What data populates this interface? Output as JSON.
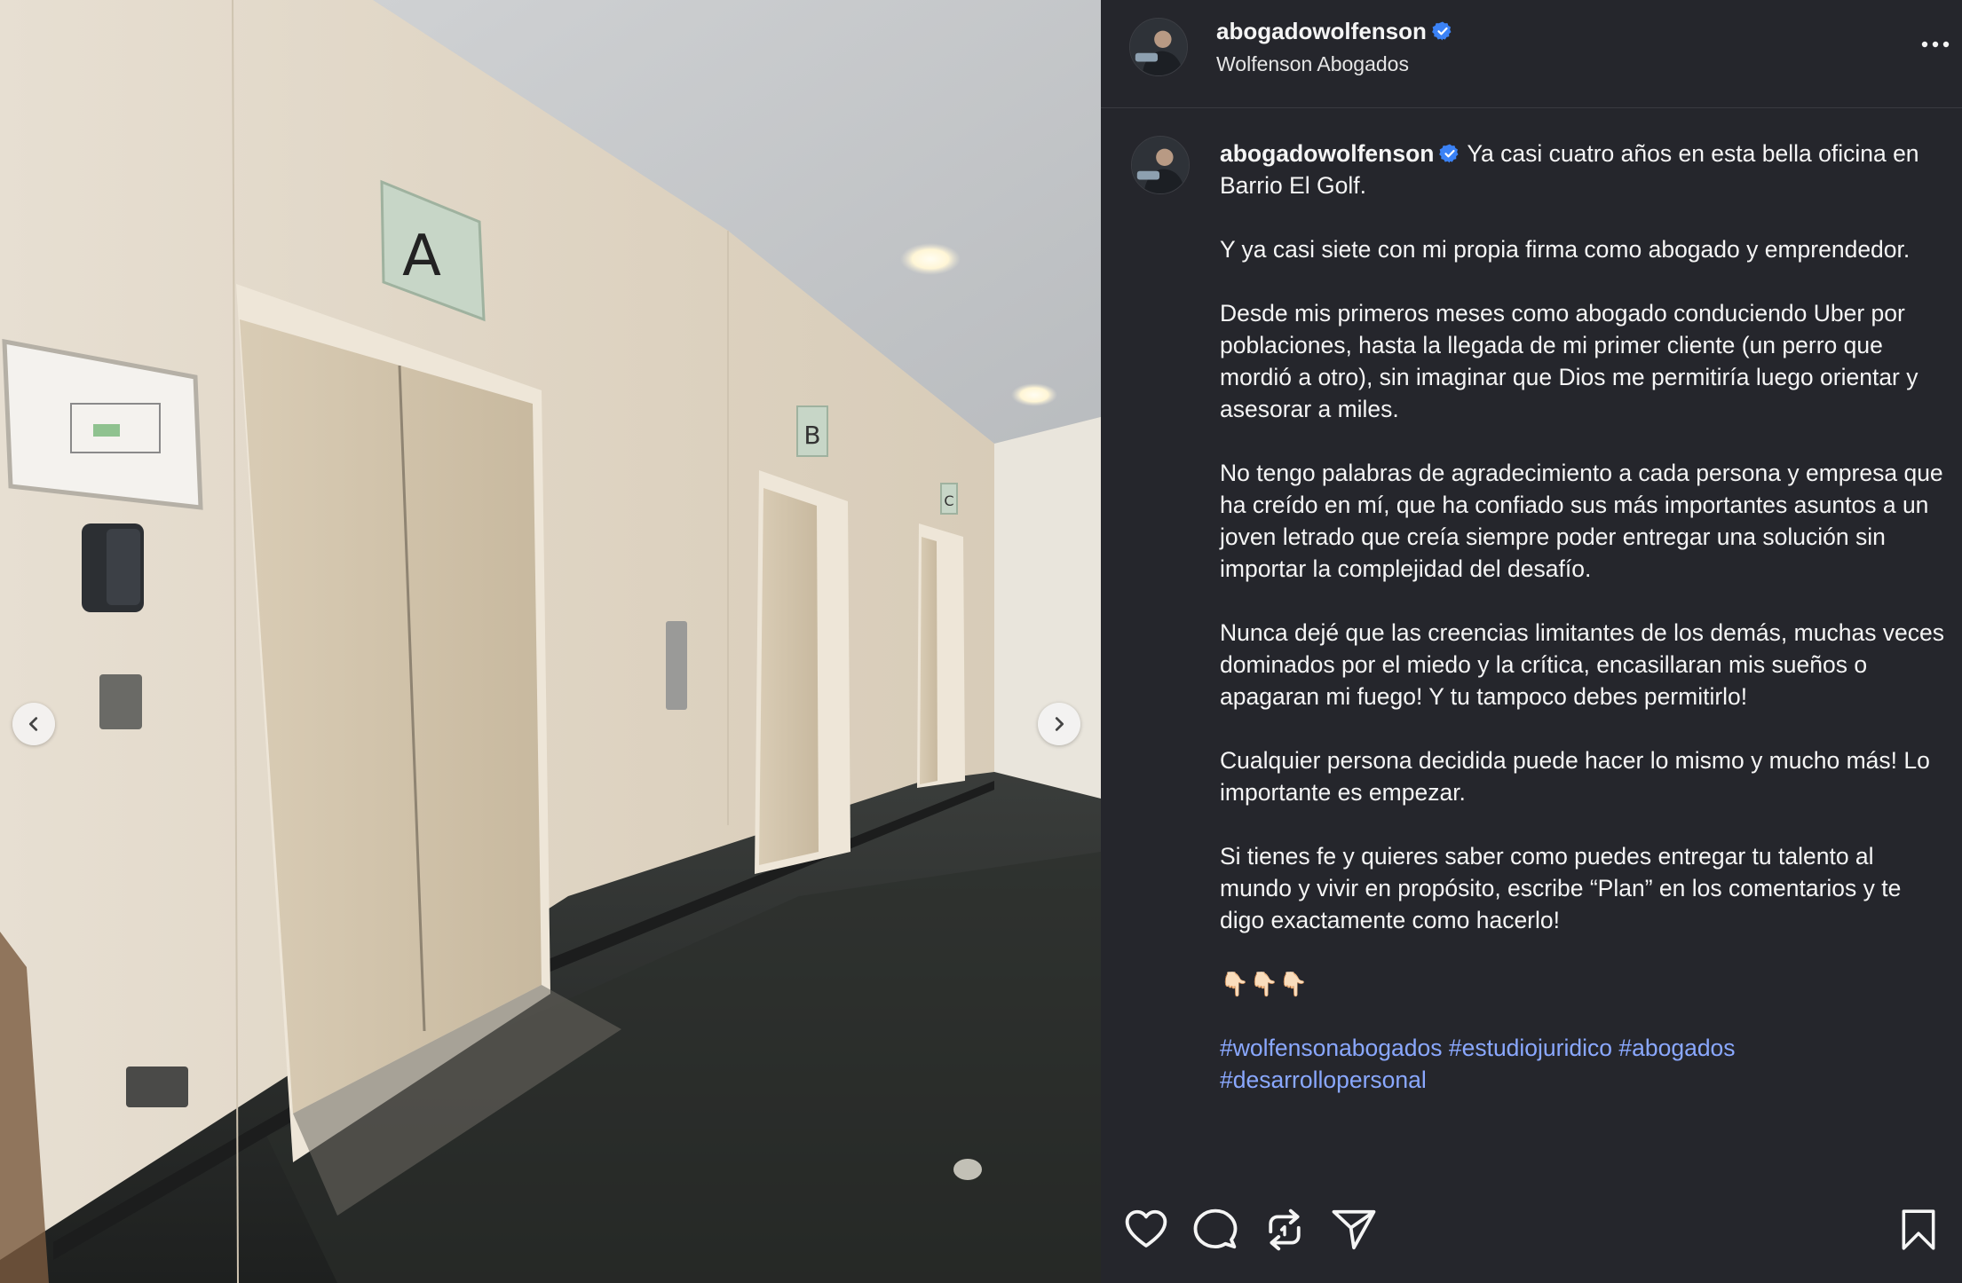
{
  "post": {
    "username": "abogadowolfenson",
    "verified": true,
    "subtitle": "Wolfenson Abogados"
  },
  "caption": {
    "username": "abogadowolfenson",
    "text": " Ya casi cuatro años en esta bella oficina en Barrio El Golf.\n\nY ya casi siete con mi propia firma como abogado y emprendedor.\n\nDesde mis primeros meses como abogado conduciendo Uber por poblaciones, hasta la llegada de mi primer cliente (un perro que mordió a otro), sin imaginar que Dios me permitiría luego orientar y asesorar a miles.\n\nNo tengo palabras de agradecimiento a cada persona y empresa que ha creído en mí, que ha confiado sus más importantes asuntos a un joven letrado que creía siempre poder entregar una solución sin importar la complejidad del desafío.\n\nNunca dejé que las creencias limitantes de los demás, muchas veces dominados por el miedo y la crítica, encasillaran mis sueños o apagaran mi fuego! Y tu tampoco debes permitirlo!\n\nCualquier persona decidida puede hacer lo mismo y mucho más! Lo importante es empezar.\n\nSi tienes fe y quieres saber como puedes entregar tu talento al mundo y vivir en propósito, escribe “Plan” en los comentarios y te digo exactamente como hacerlo!\n\n👇🏻👇🏻👇🏻\n\n",
    "hashtags": [
      "#wolfensonabogados",
      "#estudiojuridico",
      "#abogados",
      "#desarrollopersonal"
    ]
  },
  "photo": {
    "elevator_labels": [
      "A",
      "B",
      "C"
    ]
  },
  "icons": {
    "prev": "chevron-left-icon",
    "next": "chevron-right-icon",
    "more": "more-horizontal-icon",
    "like": "heart-icon",
    "comment": "comment-icon",
    "repost": "repost-icon",
    "share": "send-icon",
    "save": "bookmark-icon",
    "verified": "verified-badge-icon"
  },
  "colors": {
    "panel_bg": "#25262c",
    "hashtag": "#8aa8ff",
    "verified": "#3b82f6"
  }
}
